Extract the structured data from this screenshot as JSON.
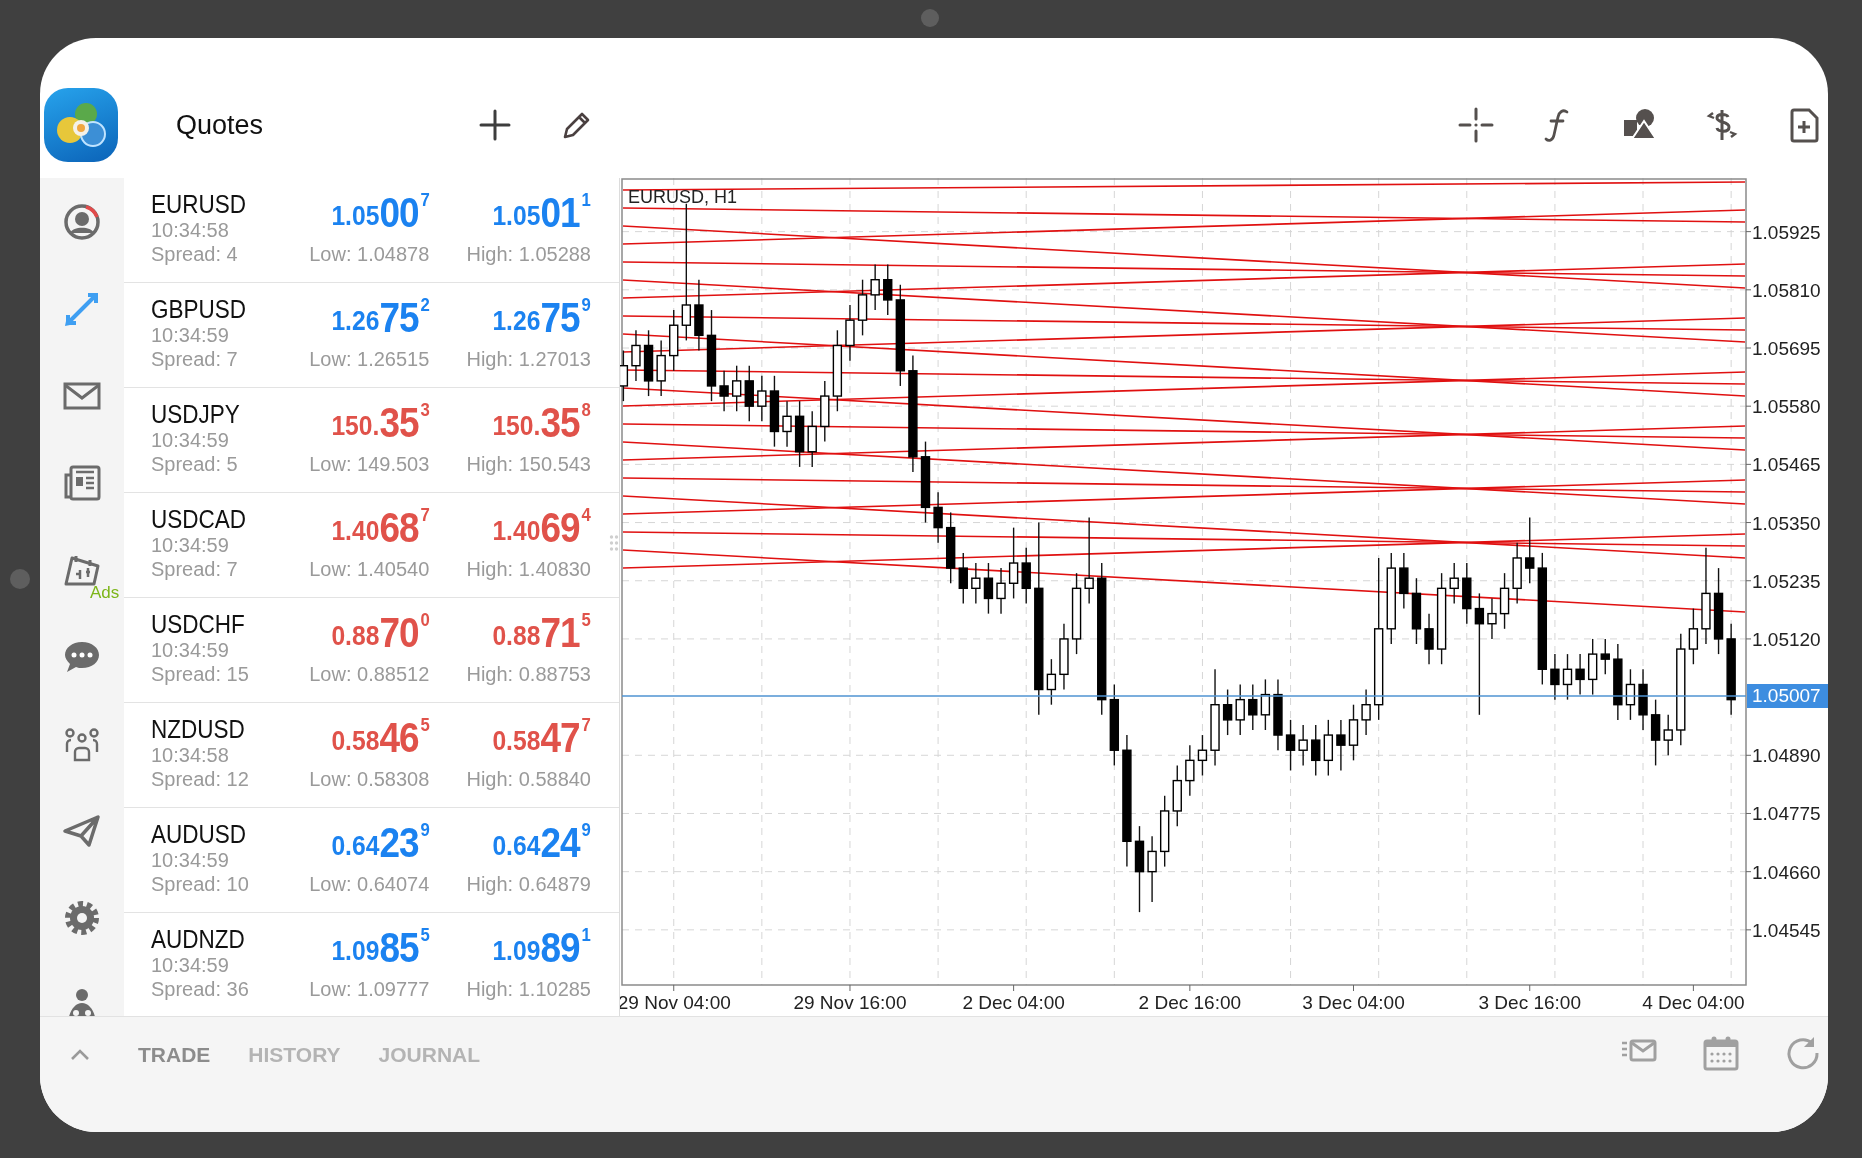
{
  "header": {
    "title": "Quotes"
  },
  "nav": [
    {
      "kind": "account",
      "selected": false
    },
    {
      "kind": "trade",
      "selected": true
    },
    {
      "kind": "mail",
      "selected": false
    },
    {
      "kind": "news",
      "selected": false
    },
    {
      "kind": "calendar",
      "badge": "Ads",
      "selected": false
    },
    {
      "kind": "chat",
      "selected": false
    },
    {
      "kind": "community",
      "selected": false
    },
    {
      "kind": "send",
      "selected": false
    },
    {
      "kind": "settings",
      "selected": false
    },
    {
      "kind": "figure",
      "selected": false
    }
  ],
  "quotes": [
    {
      "symbol": "EURUSD",
      "time": "10:34:58",
      "spread": "Spread: 4",
      "color": "#1b82f0",
      "bid": {
        "head": "1.05",
        "big": "00",
        "sup": "7"
      },
      "ask": {
        "head": "1.05",
        "big": "01",
        "sup": "1"
      },
      "low": "Low: 1.04878",
      "high": "High: 1.05288"
    },
    {
      "symbol": "GBPUSD",
      "time": "10:34:59",
      "spread": "Spread: 7",
      "color": "#1b82f0",
      "bid": {
        "head": "1.26",
        "big": "75",
        "sup": "2"
      },
      "ask": {
        "head": "1.26",
        "big": "75",
        "sup": "9"
      },
      "low": "Low: 1.26515",
      "high": "High: 1.27013"
    },
    {
      "symbol": "USDJPY",
      "time": "10:34:59",
      "spread": "Spread: 5",
      "color": "#e0524a",
      "bid": {
        "head": "150.",
        "big": "35",
        "sup": "3"
      },
      "ask": {
        "head": "150.",
        "big": "35",
        "sup": "8"
      },
      "low": "Low: 149.503",
      "high": "High: 150.543"
    },
    {
      "symbol": "USDCAD",
      "time": "10:34:59",
      "spread": "Spread: 7",
      "color": "#e0524a",
      "bid": {
        "head": "1.40",
        "big": "68",
        "sup": "7"
      },
      "ask": {
        "head": "1.40",
        "big": "69",
        "sup": "4"
      },
      "low": "Low: 1.40540",
      "high": "High: 1.40830"
    },
    {
      "symbol": "USDCHF",
      "time": "10:34:59",
      "spread": "Spread: 15",
      "color": "#e0524a",
      "bid": {
        "head": "0.88",
        "big": "70",
        "sup": "0"
      },
      "ask": {
        "head": "0.88",
        "big": "71",
        "sup": "5"
      },
      "low": "Low: 0.88512",
      "high": "High: 0.88753"
    },
    {
      "symbol": "NZDUSD",
      "time": "10:34:58",
      "spread": "Spread: 12",
      "color": "#e0524a",
      "bid": {
        "head": "0.58",
        "big": "46",
        "sup": "5"
      },
      "ask": {
        "head": "0.58",
        "big": "47",
        "sup": "7"
      },
      "low": "Low: 0.58308",
      "high": "High: 0.58840"
    },
    {
      "symbol": "AUDUSD",
      "time": "10:34:59",
      "spread": "Spread: 10",
      "color": "#1b82f0",
      "bid": {
        "head": "0.64",
        "big": "23",
        "sup": "9"
      },
      "ask": {
        "head": "0.64",
        "big": "24",
        "sup": "9"
      },
      "low": "Low: 0.64074",
      "high": "High: 0.64879"
    },
    {
      "symbol": "AUDNZD",
      "time": "10:34:59",
      "spread": "Spread: 36",
      "color": "#1b82f0",
      "bid": {
        "head": "1.09",
        "big": "85",
        "sup": "5"
      },
      "ask": {
        "head": "1.09",
        "big": "89",
        "sup": "1"
      },
      "low": "Low: 1.09777",
      "high": "High: 1.10285"
    }
  ],
  "chart": {
    "chart_data": {
      "type": "candlestick",
      "title": "EURUSD, H1",
      "grid": true,
      "ylim": [
        1.04436,
        1.06031
      ],
      "ref_lines": [
        {
          "axis": "y",
          "value": 1.05007,
          "color": "#4f93d2",
          "label": "1.05007"
        }
      ],
      "categories": [
        null,
        null,
        null,
        null,
        "29 Nov 04:00",
        null,
        null,
        null,
        null,
        null,
        null,
        null,
        null,
        null,
        null,
        null,
        null,
        null,
        "29 Nov 16:00",
        null,
        null,
        null,
        null,
        null,
        null,
        null,
        null,
        null,
        null,
        null,
        null,
        "2 Dec 04:00",
        null,
        null,
        null,
        null,
        null,
        null,
        null,
        null,
        null,
        null,
        null,
        null,
        null,
        "2 Dec 16:00",
        null,
        null,
        null,
        null,
        null,
        null,
        null,
        null,
        null,
        null,
        null,
        null,
        "3 Dec 04:00",
        null,
        null,
        null,
        null,
        null,
        null,
        null,
        null,
        null,
        null,
        null,
        null,
        null,
        "3 Dec 16:00",
        null,
        null,
        null,
        null,
        null,
        null,
        null,
        null,
        null,
        null,
        null,
        null,
        "4 Dec 04:00",
        null,
        null,
        null
      ],
      "ohlc": [
        [
          1.0562,
          1.0569,
          1.0559,
          1.0566
        ],
        [
          1.0566,
          1.0573,
          1.0563,
          1.057
        ],
        [
          1.057,
          1.0573,
          1.056,
          1.0563
        ],
        [
          1.0563,
          1.0571,
          1.056,
          1.0568
        ],
        [
          1.0568,
          1.0577,
          1.0565,
          1.0574
        ],
        [
          1.0574,
          1.0598,
          1.0571,
          1.0578
        ],
        [
          1.0578,
          1.0583,
          1.0569,
          1.0572
        ],
        [
          1.0572,
          1.0577,
          1.0559,
          1.0562
        ],
        [
          1.0562,
          1.0565,
          1.0557,
          1.056
        ],
        [
          1.056,
          1.0566,
          1.0557,
          1.0563
        ],
        [
          1.0563,
          1.0566,
          1.0555,
          1.0558
        ],
        [
          1.0558,
          1.0564,
          1.0555,
          1.0561
        ],
        [
          1.0561,
          1.0564,
          1.055,
          1.0553
        ],
        [
          1.0553,
          1.0559,
          1.055,
          1.0556
        ],
        [
          1.0556,
          1.0559,
          1.0546,
          1.0549
        ],
        [
          1.0549,
          1.0557,
          1.0546,
          1.0554
        ],
        [
          1.0554,
          1.0563,
          1.0551,
          1.056
        ],
        [
          1.056,
          1.0573,
          1.0557,
          1.057
        ],
        [
          1.057,
          1.0578,
          1.0567,
          1.0575
        ],
        [
          1.0575,
          1.0583,
          1.0572,
          1.058
        ],
        [
          1.058,
          1.0586,
          1.0577,
          1.0583
        ],
        [
          1.0583,
          1.0586,
          1.0576,
          1.0579
        ],
        [
          1.0579,
          1.0582,
          1.0562,
          1.0565
        ],
        [
          1.0565,
          1.0568,
          1.0545,
          1.0548
        ],
        [
          1.0548,
          1.0551,
          1.0535,
          1.0538
        ],
        [
          1.0538,
          1.0541,
          1.0531,
          1.0534
        ],
        [
          1.0534,
          1.0537,
          1.0523,
          1.0526
        ],
        [
          1.0526,
          1.0529,
          1.0519,
          1.0522
        ],
        [
          1.0522,
          1.0527,
          1.0519,
          1.0524
        ],
        [
          1.0524,
          1.0527,
          1.0517,
          1.052
        ],
        [
          1.052,
          1.0526,
          1.0517,
          1.0523
        ],
        [
          1.0523,
          1.0534,
          1.052,
          1.0527
        ],
        [
          1.0527,
          1.053,
          1.0519,
          1.0522
        ],
        [
          1.0522,
          1.0535,
          1.0497,
          1.0502
        ],
        [
          1.0502,
          1.0508,
          1.0499,
          1.0505
        ],
        [
          1.0505,
          1.0515,
          1.0502,
          1.0512
        ],
        [
          1.0512,
          1.0525,
          1.0509,
          1.0522
        ],
        [
          1.0522,
          1.0536,
          1.0519,
          1.0524
        ],
        [
          1.0524,
          1.0527,
          1.0497,
          1.05
        ],
        [
          1.05,
          1.0503,
          1.0487,
          1.049
        ],
        [
          1.049,
          1.0493,
          1.0467,
          1.0472
        ],
        [
          1.0472,
          1.0475,
          1.0458,
          1.0466
        ],
        [
          1.0466,
          1.0473,
          1.046,
          1.047
        ],
        [
          1.047,
          1.0481,
          1.0467,
          1.0478
        ],
        [
          1.0478,
          1.0487,
          1.0475,
          1.0484
        ],
        [
          1.0484,
          1.0491,
          1.0481,
          1.0488
        ],
        [
          1.0488,
          1.0493,
          1.0485,
          1.049
        ],
        [
          1.049,
          1.0506,
          1.0487,
          1.0499
        ],
        [
          1.0499,
          1.0502,
          1.0493,
          1.0496
        ],
        [
          1.0496,
          1.0503,
          1.0493,
          1.05
        ],
        [
          1.05,
          1.0503,
          1.0494,
          1.0497
        ],
        [
          1.0497,
          1.0504,
          1.0494,
          1.0501
        ],
        [
          1.0501,
          1.0504,
          1.049,
          1.0493
        ],
        [
          1.0493,
          1.0496,
          1.0486,
          1.049
        ],
        [
          1.049,
          1.0495,
          1.0487,
          1.0492
        ],
        [
          1.0492,
          1.0495,
          1.0485,
          1.0488
        ],
        [
          1.0488,
          1.0496,
          1.0485,
          1.0493
        ],
        [
          1.0493,
          1.0496,
          1.0486,
          1.0491
        ],
        [
          1.0491,
          1.0499,
          1.0488,
          1.0496
        ],
        [
          1.0496,
          1.0502,
          1.0493,
          1.0499
        ],
        [
          1.0499,
          1.0528,
          1.0496,
          1.0514
        ],
        [
          1.0514,
          1.0529,
          1.0511,
          1.0526
        ],
        [
          1.0526,
          1.0529,
          1.0518,
          1.0521
        ],
        [
          1.0521,
          1.0524,
          1.0511,
          1.0514
        ],
        [
          1.0514,
          1.0517,
          1.0507,
          1.051
        ],
        [
          1.051,
          1.0525,
          1.0507,
          1.0522
        ],
        [
          1.0522,
          1.0527,
          1.0519,
          1.0524
        ],
        [
          1.0524,
          1.0527,
          1.0515,
          1.0518
        ],
        [
          1.0518,
          1.0521,
          1.0497,
          1.0515
        ],
        [
          1.0515,
          1.052,
          1.0512,
          1.0517
        ],
        [
          1.0517,
          1.0525,
          1.0514,
          1.0522
        ],
        [
          1.0522,
          1.0531,
          1.0519,
          1.0528
        ],
        [
          1.0528,
          1.0536,
          1.0523,
          1.0526
        ],
        [
          1.0526,
          1.0529,
          1.0503,
          1.0506
        ],
        [
          1.0506,
          1.0509,
          1.05,
          1.0503
        ],
        [
          1.0503,
          1.0509,
          1.05,
          1.0506
        ],
        [
          1.0506,
          1.0509,
          1.0501,
          1.0504
        ],
        [
          1.0504,
          1.0512,
          1.0501,
          1.0509
        ],
        [
          1.0509,
          1.0512,
          1.0505,
          1.0508
        ],
        [
          1.0508,
          1.0511,
          1.0496,
          1.0499
        ],
        [
          1.0499,
          1.0506,
          1.0496,
          1.0503
        ],
        [
          1.0503,
          1.0506,
          1.0494,
          1.0497
        ],
        [
          1.0497,
          1.05,
          1.0487,
          1.0492
        ],
        [
          1.0492,
          1.0497,
          1.0489,
          1.0494
        ],
        [
          1.0494,
          1.0513,
          1.0491,
          1.051
        ],
        [
          1.051,
          1.0518,
          1.0507,
          1.0514
        ],
        [
          1.0514,
          1.053,
          1.0511,
          1.0521
        ],
        [
          1.0521,
          1.0526,
          1.0509,
          1.0512
        ],
        [
          1.0512,
          1.0515,
          1.0497,
          1.05
        ]
      ],
      "yticks": [
        {
          "value": 1.05925,
          "label": "1.05925"
        },
        {
          "value": 1.0581,
          "label": "1.05810"
        },
        {
          "value": 1.05695,
          "label": "1.05695"
        },
        {
          "value": 1.0558,
          "label": "1.05580"
        },
        {
          "value": 1.05465,
          "label": "1.05465"
        },
        {
          "value": 1.0535,
          "label": "1.05350"
        },
        {
          "value": 1.05235,
          "label": "1.05235"
        },
        {
          "value": 1.0512,
          "label": "1.05120"
        },
        {
          "value": 1.0489,
          "label": "1.04890"
        },
        {
          "value": 1.04775,
          "label": "1.04775"
        },
        {
          "value": 1.0466,
          "label": "1.04660"
        },
        {
          "value": 1.04545,
          "label": "1.04545"
        }
      ]
    }
  },
  "bottom_tabs": [
    {
      "label": "TRADE",
      "selected": true
    },
    {
      "label": "HISTORY",
      "selected": false
    },
    {
      "label": "JOURNAL",
      "selected": false
    }
  ]
}
